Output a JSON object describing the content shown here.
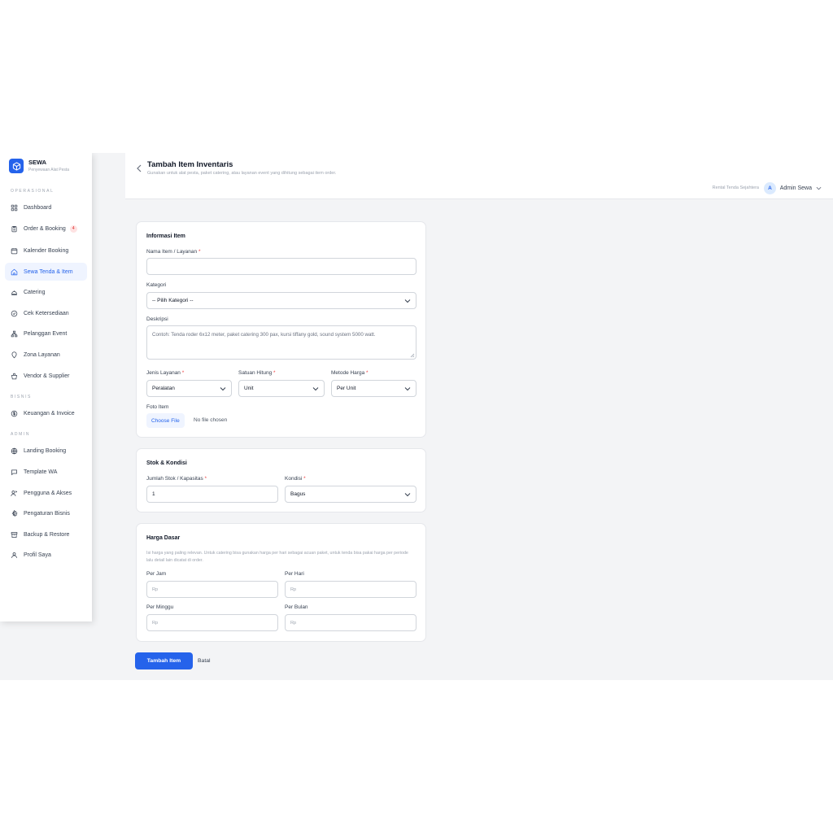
{
  "app": {
    "name": "SEWA",
    "tagline": "Penyewaan Alat Pesta"
  },
  "sidebar": {
    "sections": [
      {
        "label": "OPERASIONAL"
      },
      {
        "label": "BISNIS"
      },
      {
        "label": "ADMIN"
      }
    ],
    "items": [
      {
        "label": "Dashboard",
        "icon": "grid-icon"
      },
      {
        "label": "Order & Booking",
        "icon": "clipboard-icon",
        "badge": "4"
      },
      {
        "label": "Kalender Booking",
        "icon": "calendar-icon"
      },
      {
        "label": "Sewa Tenda & Item",
        "icon": "tent-icon",
        "active": true
      },
      {
        "label": "Catering",
        "icon": "cloche-icon"
      },
      {
        "label": "Cek Ketersediaan",
        "icon": "check-circle-icon"
      },
      {
        "label": "Pelanggan Event",
        "icon": "org-chart-icon"
      },
      {
        "label": "Zona Layanan",
        "icon": "map-pin-icon"
      },
      {
        "label": "Vendor & Supplier",
        "icon": "bag-icon"
      },
      {
        "label": "Keuangan & Invoice",
        "icon": "dollar-circle-icon"
      },
      {
        "label": "Landing Booking",
        "icon": "globe-icon"
      },
      {
        "label": "Template WA",
        "icon": "chat-icon"
      },
      {
        "label": "Pengguna & Akses",
        "icon": "user-key-icon"
      },
      {
        "label": "Pengaturan Bisnis",
        "icon": "gear-icon"
      },
      {
        "label": "Backup & Restore",
        "icon": "archive-icon"
      },
      {
        "label": "Profil Saya",
        "icon": "user-icon"
      }
    ]
  },
  "header": {
    "title": "Tambah Item Inventaris",
    "subtitle": "Gunakan untuk alat pesta, paket catering, atau layanan event yang dihitung sebagai item order.",
    "tenant": "Rental Tenda Sejahtera",
    "avatar_initial": "A",
    "user_name": "Admin Sewa"
  },
  "info_card": {
    "title": "Informasi Item",
    "name_label": "Nama Item / Layanan",
    "name_value": "",
    "category_label": "Kategori",
    "category_value": "-- Pilih Kategori --",
    "description_label": "Deskripsi",
    "description_placeholder": "Contoh: Tenda roder 6x12 meter, paket catering 300 pax, kursi tiffany gold, sound system 5000 watt.",
    "service_type_label": "Jenis Layanan",
    "service_type_value": "Peralatan",
    "unit_label": "Satuan Hitung",
    "unit_value": "Unit",
    "price_method_label": "Metode Harga",
    "price_method_value": "Per Unit",
    "photo_label": "Foto Item",
    "choose_file": "Choose File",
    "no_file": "No file chosen",
    "required_mark": "*"
  },
  "stock_card": {
    "title": "Stok & Kondisi",
    "qty_label": "Jumlah Stok / Kapasitas",
    "qty_value": "1",
    "condition_label": "Kondisi",
    "condition_value": "Bagus"
  },
  "price_card": {
    "title": "Harga Dasar",
    "hint": "Isi harga yang paling relevan. Untuk catering bisa gunakan harga per hari sebagai acuan paket, untuk tenda bisa pakai harga per periode lalu detail lain dicatat di order.",
    "per_hour_label": "Per Jam",
    "per_day_label": "Per Hari",
    "per_week_label": "Per Minggu",
    "per_month_label": "Per Bulan",
    "placeholder": "Rp"
  },
  "actions": {
    "submit": "Tambah Item",
    "cancel": "Batal"
  },
  "colors": {
    "primary": "#2563eb",
    "active_bg": "#eff4ff",
    "required": "#ef4444",
    "page_bg": "#f3f4f6"
  }
}
